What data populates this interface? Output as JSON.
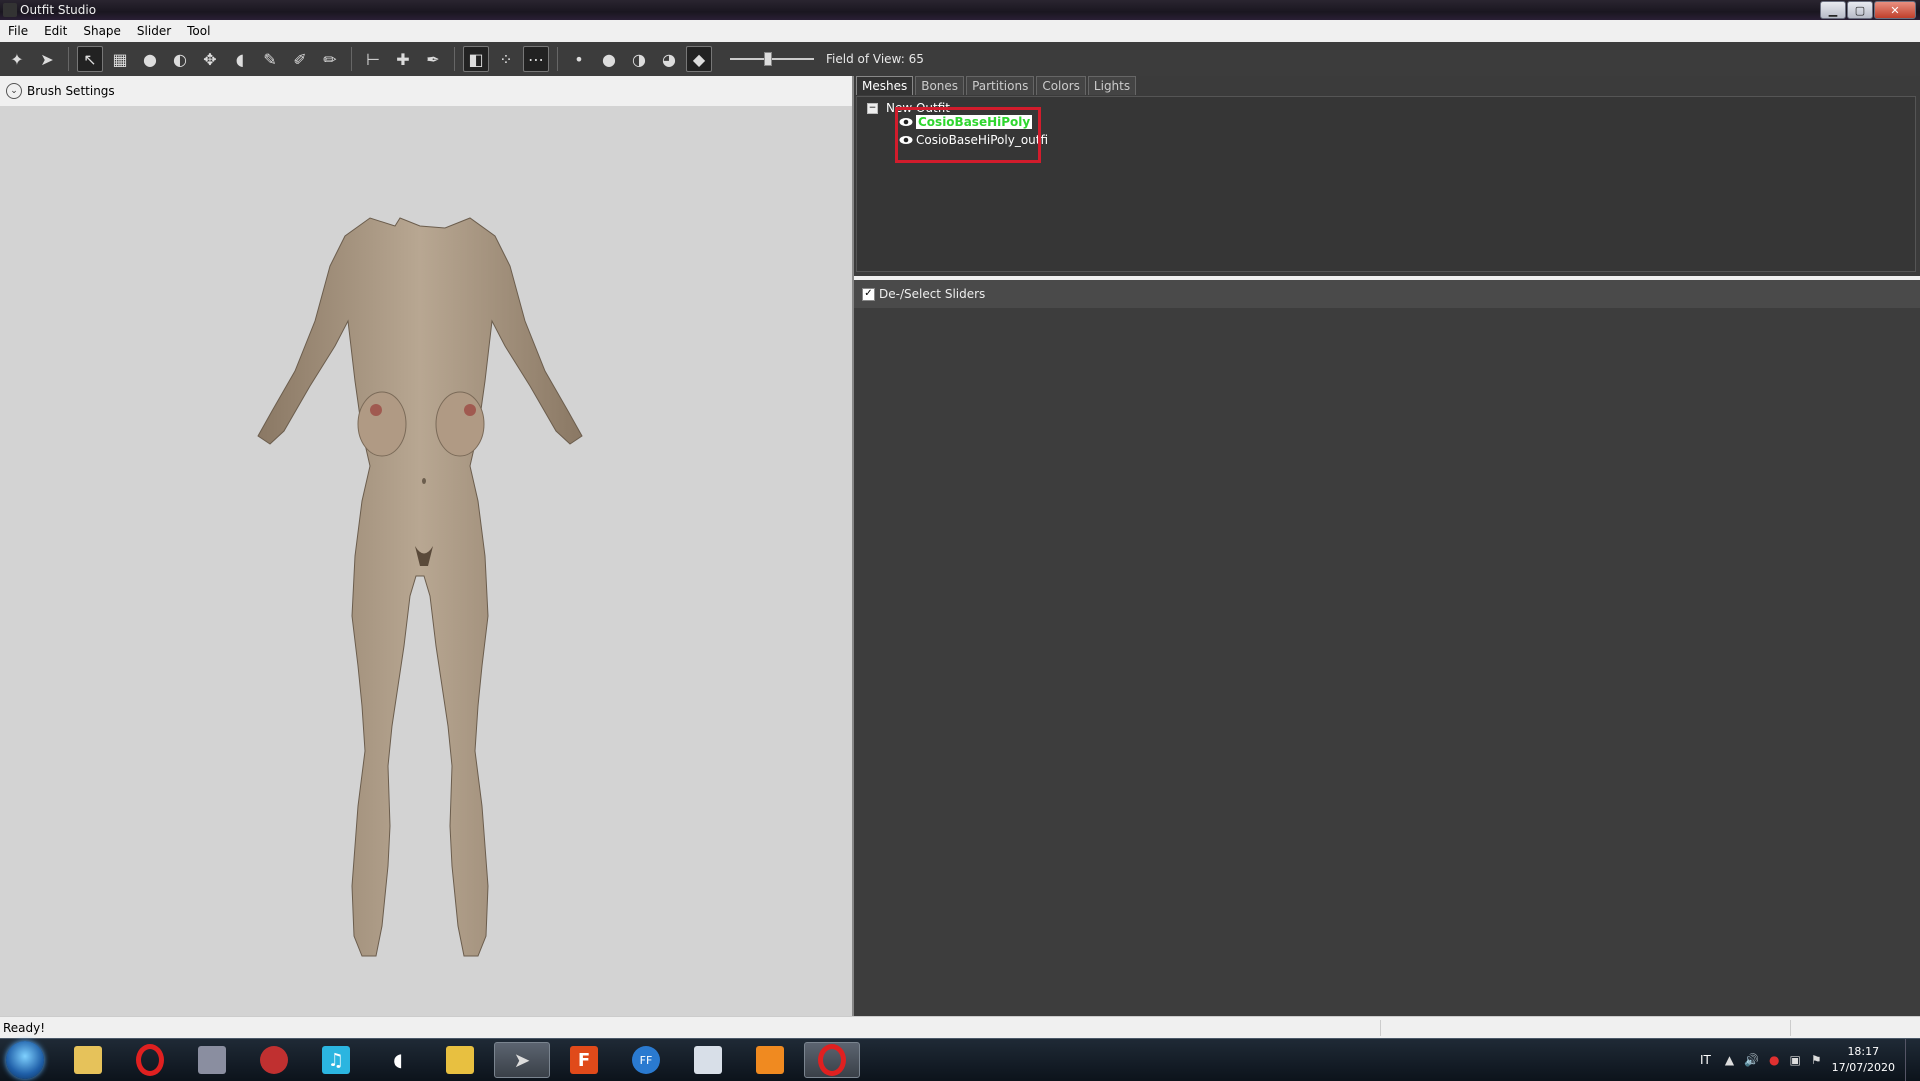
{
  "window": {
    "title": "Outfit Studio"
  },
  "menu": [
    "File",
    "Edit",
    "Shape",
    "Slider",
    "Tool"
  ],
  "toolbar": {
    "fov_label": "Field of View: 65",
    "fov_value": 65
  },
  "brush_settings": {
    "label": "Brush Settings"
  },
  "tabs": [
    "Meshes",
    "Bones",
    "Partitions",
    "Colors",
    "Lights"
  ],
  "active_tab": "Meshes",
  "mesh_tree": {
    "root": "New Outfit",
    "items": [
      {
        "name": "CosioBaseHiPoly",
        "selected": true
      },
      {
        "name": "CosioBaseHiPoly_outfi",
        "selected": false
      }
    ]
  },
  "sliders": {
    "label": "De-/Select Sliders",
    "checked": true
  },
  "status": {
    "text": "Ready!"
  },
  "taskbar": {
    "language": "IT",
    "time": "18:17",
    "date": "17/07/2020"
  },
  "colors": {
    "selection_box": "#d21c2c",
    "selected_text": "#2fd62f"
  }
}
